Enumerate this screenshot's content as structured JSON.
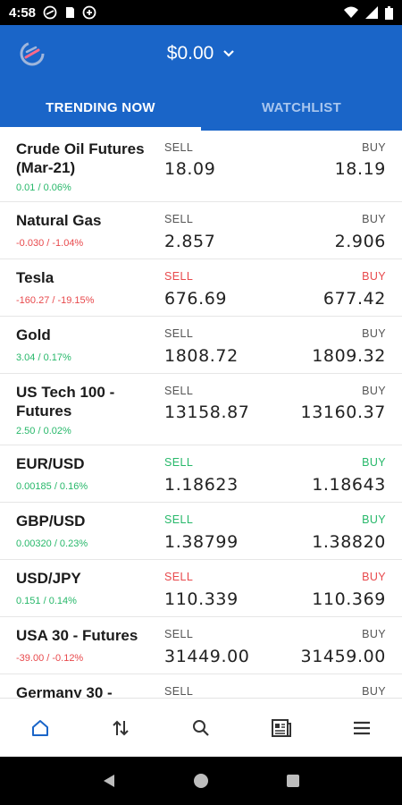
{
  "status_bar": {
    "time": "4:58"
  },
  "header": {
    "balance": "$0.00",
    "tabs": [
      {
        "label": "TRENDING NOW",
        "active": true
      },
      {
        "label": "WATCHLIST",
        "active": false
      }
    ]
  },
  "instruments": [
    {
      "name": "Crude Oil Futures (Mar-21)",
      "change": "0.01 / 0.06%",
      "direction": "up",
      "sell_label": "SELL",
      "buy_label": "BUY",
      "sell": "18.09",
      "buy": "18.19",
      "label_color": "neutral"
    },
    {
      "name": "Natural Gas",
      "change": "-0.030 / -1.04%",
      "direction": "down",
      "sell_label": "SELL",
      "buy_label": "BUY",
      "sell": "2.857",
      "buy": "2.906",
      "label_color": "neutral"
    },
    {
      "name": "Tesla",
      "change": "-160.27 / -19.15%",
      "direction": "down",
      "sell_label": "SELL",
      "buy_label": "BUY",
      "sell": "676.69",
      "buy": "677.42",
      "label_color": "red"
    },
    {
      "name": "Gold",
      "change": "3.04 / 0.17%",
      "direction": "up",
      "sell_label": "SELL",
      "buy_label": "BUY",
      "sell": "1808.72",
      "buy": "1809.32",
      "label_color": "neutral"
    },
    {
      "name": "US Tech 100 - Futures",
      "change": "2.50 / 0.02%",
      "direction": "up",
      "sell_label": "SELL",
      "buy_label": "BUY",
      "sell": "13158.87",
      "buy": "13160.37",
      "label_color": "neutral"
    },
    {
      "name": "EUR/USD",
      "change": "0.00185 / 0.16%",
      "direction": "up",
      "sell_label": "SELL",
      "buy_label": "BUY",
      "sell": "1.18623",
      "buy": "1.18643",
      "label_color": "green"
    },
    {
      "name": "GBP/USD",
      "change": "0.00320 / 0.23%",
      "direction": "up",
      "sell_label": "SELL",
      "buy_label": "BUY",
      "sell": "1.38799",
      "buy": "1.38820",
      "label_color": "green"
    },
    {
      "name": "USD/JPY",
      "change": "0.151 / 0.14%",
      "direction": "up",
      "sell_label": "SELL",
      "buy_label": "BUY",
      "sell": "110.339",
      "buy": "110.369",
      "label_color": "red"
    },
    {
      "name": "USA 30 - Futures",
      "change": "-39.00 / -0.12%",
      "direction": "down",
      "sell_label": "SELL",
      "buy_label": "BUY",
      "sell": "31449.00",
      "buy": "31459.00",
      "label_color": "neutral"
    },
    {
      "name": "Germany 30 -",
      "change": "",
      "direction": "up",
      "sell_label": "SELL",
      "buy_label": "BUY",
      "sell": "",
      "buy": "",
      "label_color": "neutral"
    }
  ],
  "bottom_nav": [
    {
      "icon": "home-icon",
      "active": true
    },
    {
      "icon": "sort-arrows-icon",
      "active": false
    },
    {
      "icon": "search-icon",
      "active": false
    },
    {
      "icon": "news-icon",
      "active": false
    },
    {
      "icon": "menu-icon",
      "active": false
    }
  ],
  "colors": {
    "brand": "#1a65c8",
    "up": "#27b86a",
    "down": "#e8494c"
  }
}
